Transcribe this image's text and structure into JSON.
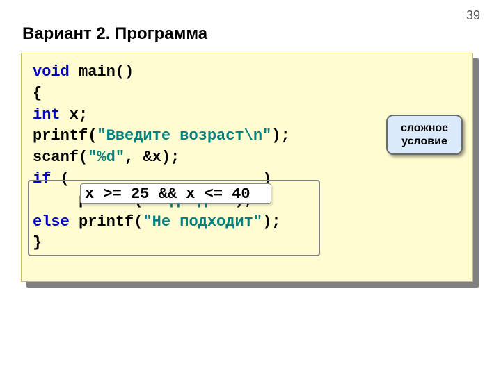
{
  "page_number": "39",
  "title": "Вариант 2. Программа",
  "code": {
    "l1a": "void",
    "l1b": " main()",
    "l2": "{",
    "l3a": "int",
    "l3b": " x;",
    "l4a": "printf(",
    "l4b": "\"Введите возраст\\n\"",
    "l4c": ");",
    "l5a": "scanf(",
    "l5b": "\"%d\"",
    "l5c": ", &x);",
    "l6a": "if",
    "l6b": " (                     )",
    "l7a": "     ",
    "l7b": "printf(",
    "l7c": "\"Подходит\"",
    "l7d": ");",
    "l8a": "else",
    "l8b": " printf(",
    "l8c": "\"Не подходит\"",
    "l8d": ");",
    "l9": "}"
  },
  "condition_highlight": "x >= 25 && x <= 40",
  "callout_line1": "сложное",
  "callout_line2": "условие"
}
